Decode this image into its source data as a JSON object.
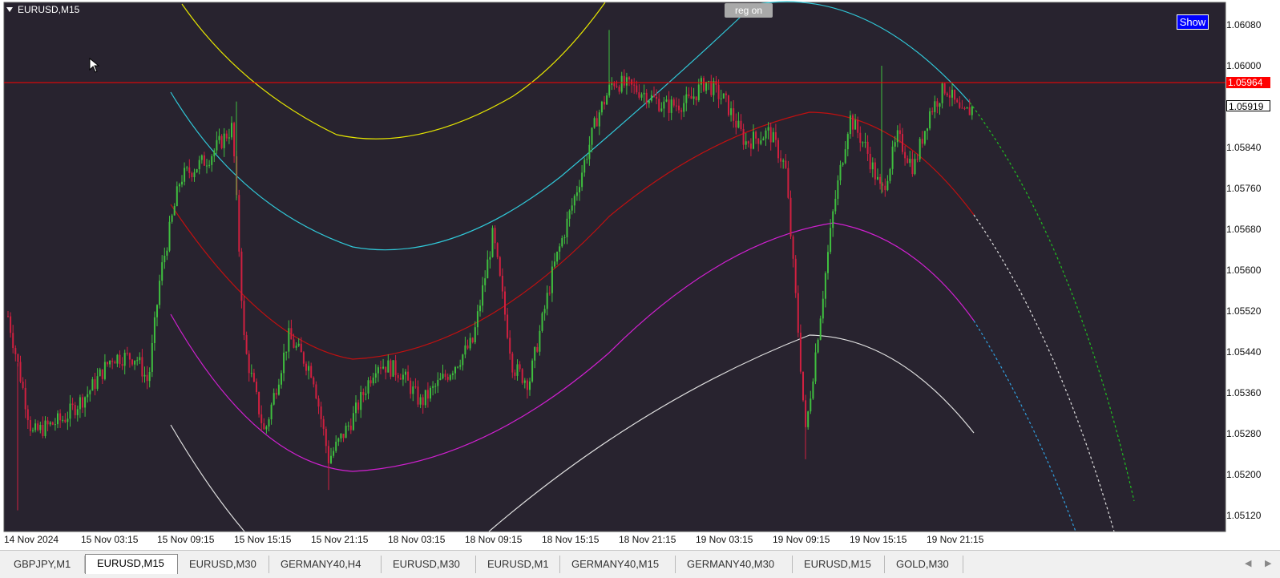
{
  "chart": {
    "symbol_title": "EURUSD,M15",
    "reg_button": "reg on",
    "show_button": "Show",
    "background": "#28232f",
    "current_price": "1.05964",
    "current_price_color": "#ff0000",
    "marker_price": "1.05919",
    "price_labels": [
      "1.06080",
      "1.06000",
      "1.05840",
      "1.05760",
      "1.05680",
      "1.05600",
      "1.05520",
      "1.05440",
      "1.05360",
      "1.05280",
      "1.05200",
      "1.05120"
    ],
    "time_labels": [
      "14 Nov 2024",
      "15 Nov 03:15",
      "15 Nov 09:15",
      "15 Nov 15:15",
      "15 Nov 21:15",
      "18 Nov 03:15",
      "18 Nov 09:15",
      "18 Nov 15:15",
      "18 Nov 21:15",
      "19 Nov 03:15",
      "19 Nov 09:15",
      "19 Nov 15:15",
      "19 Nov 21:15"
    ],
    "bull_color": "#3fbf3f",
    "bear_color": "#d02040"
  },
  "tabs": [
    {
      "label": "GBPJPY,M1",
      "active": false
    },
    {
      "label": "EURUSD,M15",
      "active": true
    },
    {
      "label": "EURUSD,M30",
      "active": false
    },
    {
      "label": "GERMANY40,H4",
      "active": false
    },
    {
      "label": "EURUSD,M30",
      "active": false
    },
    {
      "label": "EURUSD,M1",
      "active": false
    },
    {
      "label": "GERMANY40,M15",
      "active": false
    },
    {
      "label": "GERMANY40,M30",
      "active": false
    },
    {
      "label": "EURUSD,M15",
      "active": false
    },
    {
      "label": "GOLD,M30",
      "active": false
    }
  ],
  "nav": {
    "left": "◀",
    "right": "▶"
  }
}
